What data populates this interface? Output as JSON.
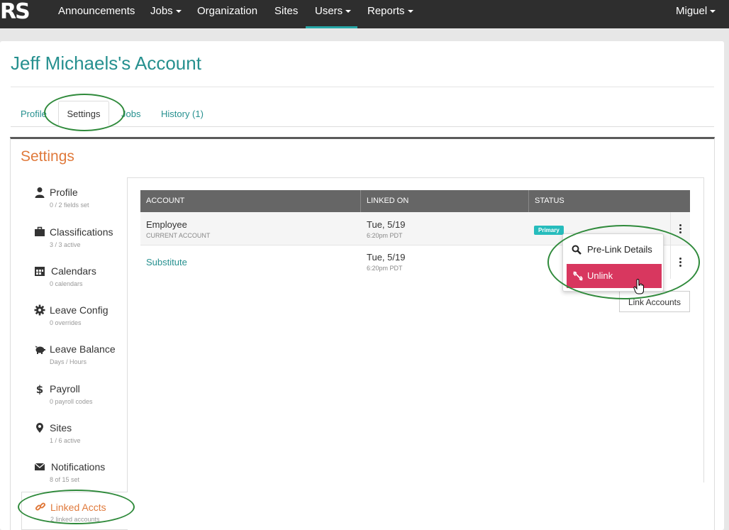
{
  "app": {
    "logo": "RS",
    "nav": [
      {
        "label": "Announcements"
      },
      {
        "label": "Jobs",
        "dropdown": true
      },
      {
        "label": "Organization"
      },
      {
        "label": "Sites"
      },
      {
        "label": "Users",
        "dropdown": true,
        "active": true
      },
      {
        "label": "Reports",
        "dropdown": true
      }
    ],
    "user_menu": "Miguel"
  },
  "page": {
    "title": "Jeff Michaels's Account",
    "tabs": [
      {
        "label": "Profile"
      },
      {
        "label": "Settings",
        "active": true
      },
      {
        "label": "Jobs"
      },
      {
        "label": "History (1)"
      }
    ]
  },
  "settings": {
    "title": "Settings",
    "sidebar": [
      {
        "label": "Profile",
        "sub": "0 / 2 fields set",
        "icon": "user-icon"
      },
      {
        "label": "Classifications",
        "sub": "3 / 3 active",
        "icon": "briefcase-icon"
      },
      {
        "label": "Calendars",
        "sub": "0 calendars",
        "icon": "calendar-icon"
      },
      {
        "label": "Leave Config",
        "sub": "0 overrides",
        "icon": "gear-icon"
      },
      {
        "label": "Leave Balance",
        "sub": "Days / Hours",
        "icon": "piggy-bank-icon"
      },
      {
        "label": "Payroll",
        "sub": "0 payroll codes",
        "icon": "dollar-icon"
      },
      {
        "label": "Sites",
        "sub": "1 / 6 active",
        "icon": "map-marker-icon"
      },
      {
        "label": "Notifications",
        "sub": "8 of 15 set",
        "icon": "envelope-icon"
      },
      {
        "label": "Linked Accts",
        "sub": "2 linked accounts",
        "icon": "link-icon",
        "active": true
      }
    ]
  },
  "linked_accounts": {
    "columns": [
      "ACCOUNT",
      "LINKED ON",
      "STATUS"
    ],
    "rows": [
      {
        "account": "Employee",
        "account_sub": "CURRENT ACCOUNT",
        "linked_on": "Tue, 5/19",
        "linked_time": "6:20pm PDT",
        "status": "Primary"
      },
      {
        "account": "Substitute",
        "linked_on": "Tue, 5/19",
        "linked_time": "6:20pm PDT"
      }
    ],
    "link_button": "Link Accounts",
    "menu": {
      "items": [
        {
          "label": "Pre-Link Details",
          "icon": "search-icon"
        },
        {
          "label": "Unlink",
          "icon": "unlink-icon",
          "highlighted": true
        }
      ]
    }
  },
  "colors": {
    "teal": "#26908f",
    "orange": "#e07a3c",
    "unlink_red": "#d8375f",
    "badge": "#26bcbc",
    "annotation_green": "#2f8a3b"
  }
}
